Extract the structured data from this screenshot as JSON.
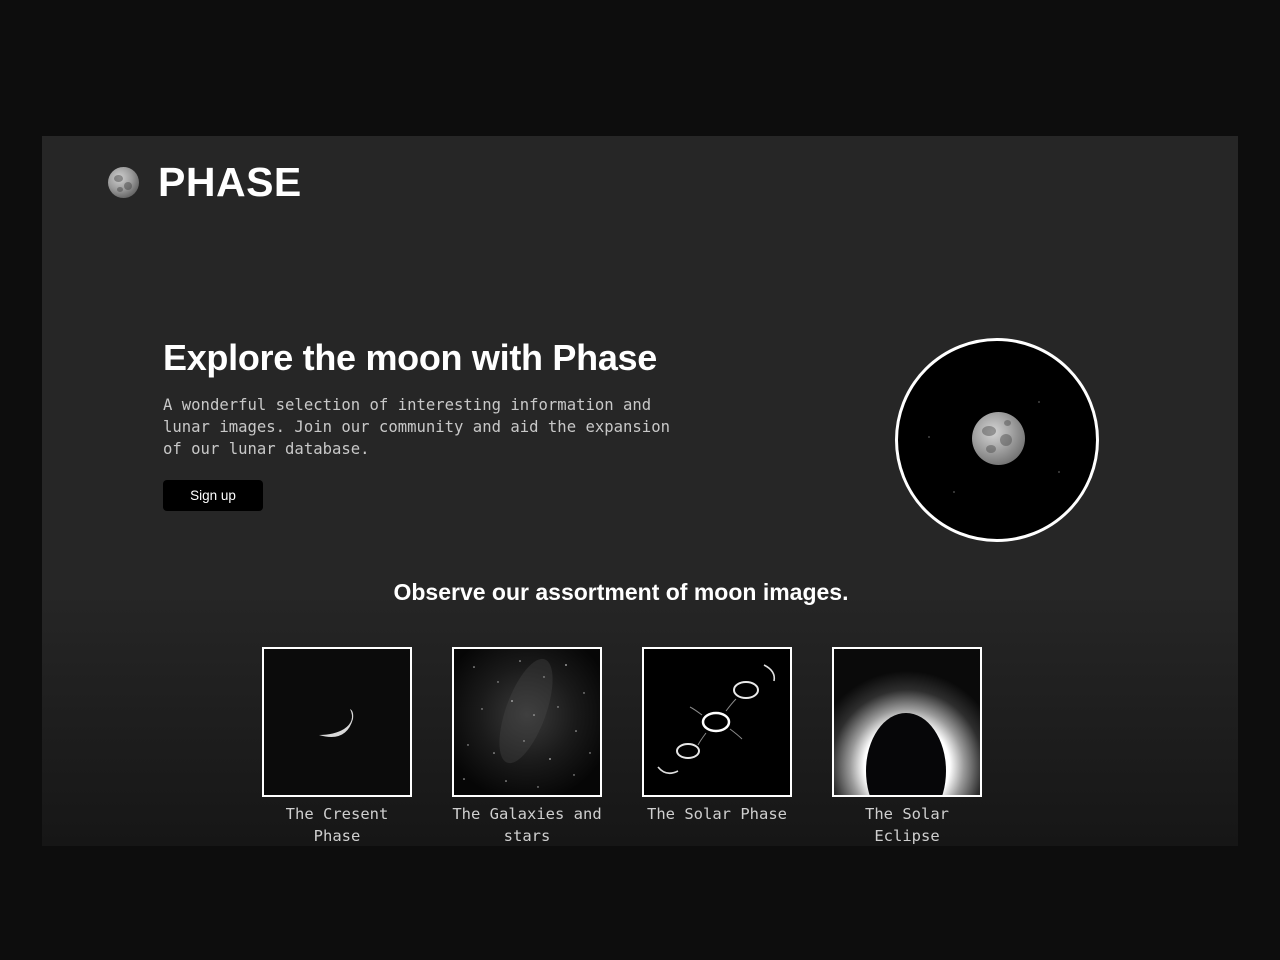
{
  "brand": {
    "name": "PHASE",
    "logo_icon": "moon-icon"
  },
  "hero": {
    "title": "Explore the moon with Phase",
    "description": "A wonderful selection of interesting information and lunar images. Join our community and aid the expansion of our lunar database.",
    "signup_label": "Sign up",
    "image_icon": "full-moon-image"
  },
  "gallery": {
    "title": "Observe our assortment of moon images.",
    "items": [
      {
        "caption": "The Cresent Phase",
        "image": "crescent-moon-image"
      },
      {
        "caption": "The Galaxies and stars",
        "image": "galaxy-stars-image"
      },
      {
        "caption": "The Solar Phase",
        "image": "solar-phase-sequence-image"
      },
      {
        "caption": "The Solar Eclipse",
        "image": "solar-eclipse-image"
      }
    ]
  },
  "colors": {
    "page_background": "#0d0d0d",
    "panel_background": "#262626",
    "text_primary": "#ffffff",
    "text_secondary": "#c8c8c8",
    "button_background": "#000000"
  }
}
